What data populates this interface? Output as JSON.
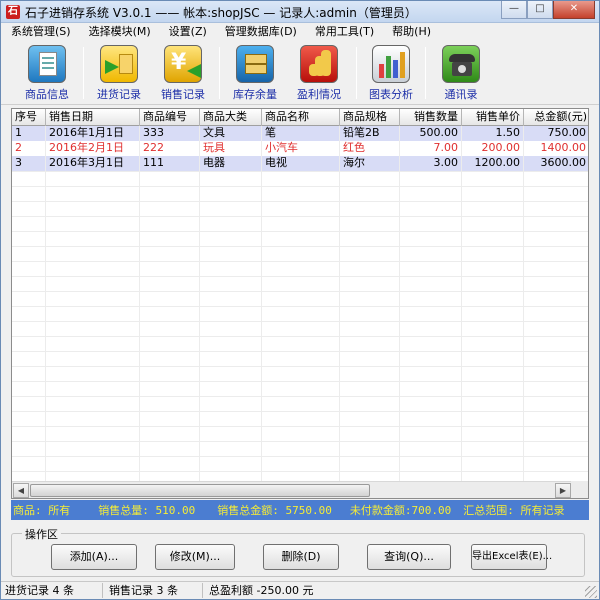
{
  "window": {
    "title": "石子进销存系统 V3.0.1 —— 帐本:shopJSC — 记录人:admin（管理员）",
    "icon_name": "app-logo-icon",
    "minimize": "—",
    "maximize": "□",
    "close": "✕"
  },
  "menu": [
    "系统管理(S)",
    "选择模块(M)",
    "设置(Z)",
    "管理数据库(D)",
    "常用工具(T)",
    "帮助(H)"
  ],
  "toolbar": [
    {
      "label": "商品信息",
      "icon": "product-info-icon",
      "color": "#2f8fd6"
    },
    {
      "label": "进货记录",
      "icon": "purchase-record-icon",
      "color": "#f2c218"
    },
    {
      "label": "销售记录",
      "icon": "sales-record-icon",
      "color": "#e8b10d"
    },
    {
      "label": "库存余量",
      "icon": "inventory-icon",
      "color": "#1f7fc6"
    },
    {
      "label": "盈利情况",
      "icon": "profit-icon",
      "color": "#d9261c"
    },
    {
      "label": "图表分析",
      "icon": "chart-analysis-icon",
      "color": "#cfd5dc"
    },
    {
      "label": "通讯录",
      "icon": "contacts-phone-icon",
      "color": "#4aa02c"
    }
  ],
  "table": {
    "columns": [
      "序号",
      "销售日期",
      "商品编号",
      "商品大类",
      "商品名称",
      "商品规格",
      "销售数量",
      "销售单价",
      "总金额(元)"
    ],
    "rows": [
      [
        "1",
        "2016年1月1日",
        "333",
        "文具",
        "笔",
        "铅笔2B",
        "500.00",
        "1.50",
        "750.00"
      ],
      [
        "2",
        "2016年2月1日",
        "222",
        "玩具",
        "小汽车",
        "红色",
        "7.00",
        "200.00",
        "1400.00"
      ],
      [
        "3",
        "2016年3月1日",
        "111",
        "电器",
        "电视",
        "海尔",
        "3.00",
        "1200.00",
        "3600.00"
      ]
    ],
    "highlight_row_color": "#e03030"
  },
  "summary": {
    "product": "商品: 所有",
    "total_qty": "销售总量: 510.00",
    "total_amount": "销售总金额: 5750.00",
    "unpaid": "未付款金额:700.00",
    "range": "汇总范围: 所有记录"
  },
  "ops": {
    "title": "操作区",
    "add": "添加(A)...",
    "edit": "修改(M)...",
    "delete": "删除(D)",
    "query": "查询(Q)...",
    "export": "导出Excel表(E)..."
  },
  "status": {
    "purchase": "进货记录 4 条",
    "sales": "销售记录 3 条",
    "profit": "总盈利额 -250.00 元"
  },
  "colors": {
    "summary_bg": "#4b7dd1",
    "summary_text": "#f5ec37",
    "row_alt": "#d8dcf6",
    "toolbar_label": "#1d2fa8"
  }
}
